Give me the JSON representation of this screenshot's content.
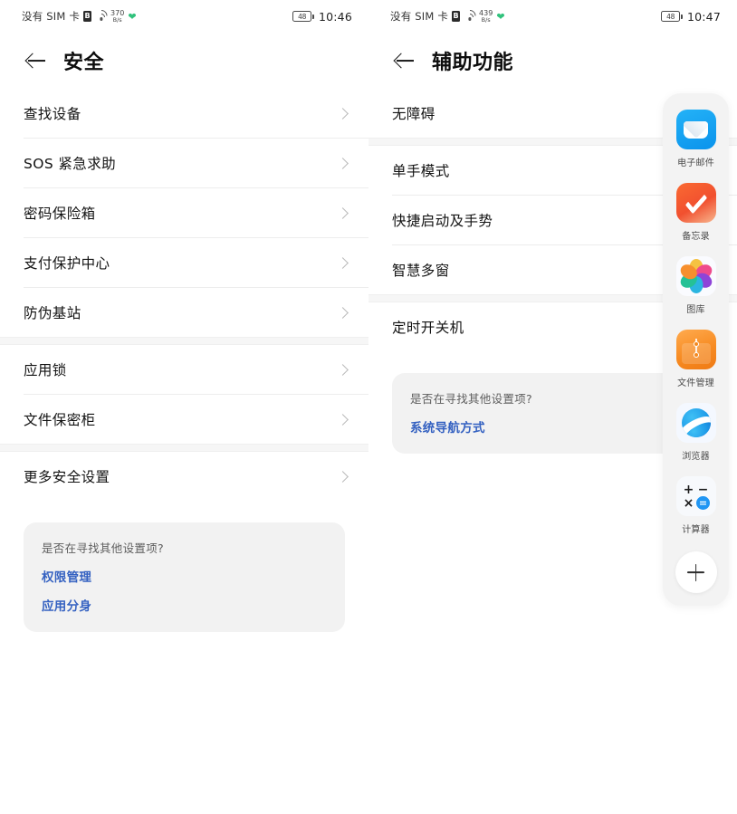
{
  "left_phone": {
    "status_bar": {
      "carrier": "没有 SIM 卡",
      "sim_badge": "B",
      "wifi_icon": "wifi-icon",
      "net_speed_value": "370",
      "net_speed_unit": "B/s",
      "heart_icon": "heart-icon",
      "battery_level": "48",
      "time": "10:46"
    },
    "header": {
      "back_icon": "back-arrow-icon",
      "title": "安全"
    },
    "groups": [
      {
        "items": [
          {
            "label": "查找设备"
          },
          {
            "label": "SOS 紧急求助"
          },
          {
            "label": "密码保险箱"
          },
          {
            "label": "支付保护中心"
          },
          {
            "label": "防伪基站"
          }
        ]
      },
      {
        "items": [
          {
            "label": "应用锁"
          },
          {
            "label": "文件保密柜"
          }
        ]
      },
      {
        "items": [
          {
            "label": "更多安全设置"
          }
        ]
      }
    ],
    "suggestion_card": {
      "title": "是否在寻找其他设置项?",
      "links": [
        "权限管理",
        "应用分身"
      ]
    }
  },
  "right_phone": {
    "status_bar": {
      "carrier": "没有 SIM 卡",
      "sim_badge": "B",
      "wifi_icon": "wifi-icon",
      "net_speed_value": "439",
      "net_speed_unit": "B/s",
      "heart_icon": "heart-icon",
      "battery_level": "48",
      "time": "10:47"
    },
    "header": {
      "back_icon": "back-arrow-icon",
      "title": "辅助功能"
    },
    "groups": [
      {
        "items": [
          {
            "label": "无障碍"
          }
        ]
      },
      {
        "items": [
          {
            "label": "单手模式"
          },
          {
            "label": "快捷启动及手势"
          },
          {
            "label": "智慧多窗"
          }
        ]
      },
      {
        "items": [
          {
            "label": "定时开关机"
          }
        ]
      }
    ],
    "suggestion_card": {
      "title": "是否在寻找其他设置项?",
      "links": [
        "系统导航方式"
      ]
    },
    "dock": {
      "apps": [
        {
          "label": "电子邮件",
          "icon": "email-icon",
          "color": "#0a93ec"
        },
        {
          "label": "备忘录",
          "icon": "notes-icon",
          "color": "#f1502f"
        },
        {
          "label": "图库",
          "icon": "gallery-icon",
          "color": "#fafbff"
        },
        {
          "label": "文件管理",
          "icon": "files-icon",
          "color": "#f78b22"
        },
        {
          "label": "浏览器",
          "icon": "browser-icon",
          "color": "#1e9ae8"
        },
        {
          "label": "计算器",
          "icon": "calculator-icon",
          "color": "#2196f3"
        }
      ],
      "add_button_icon": "plus-icon",
      "calculator_symbols": {
        "plus": "+",
        "minus": "−",
        "times": "×",
        "equals": "="
      }
    }
  },
  "theme": {
    "accent_link": "#3461c1",
    "card_bg": "#f2f2f2",
    "separator": "#ededed",
    "text_primary": "#131313"
  }
}
